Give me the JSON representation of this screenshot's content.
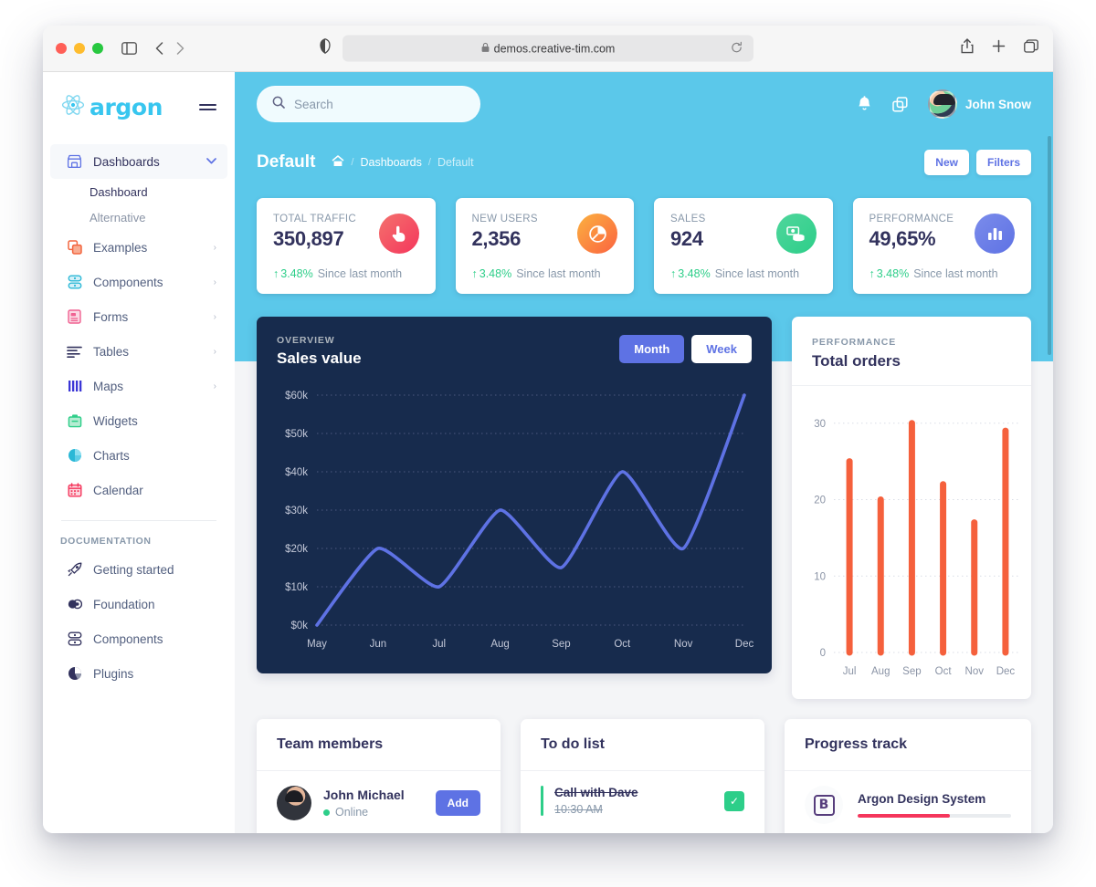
{
  "browser": {
    "url": "demos.creative-tim.com",
    "lock_icon": "lock-icon",
    "reload_icon": "reload-icon",
    "sidebar_icon": "sidebar-toggle-icon",
    "back_icon": "chevron-left-icon",
    "forward_icon": "chevron-right-icon",
    "shield_icon": "privacy-shield-icon",
    "share_icon": "share-icon",
    "new_tab_icon": "plus-icon",
    "tabs_icon": "tab-overview-icon"
  },
  "sidebar": {
    "logo_text": "argon",
    "logo_icon": "react-atom-icon",
    "burger_icon": "hamburger-icon",
    "items": [
      {
        "label": "Dashboards",
        "icon": "store-icon",
        "color": "#5e72e4",
        "caret": "chevron-down-icon",
        "active": true
      },
      {
        "label": "Examples",
        "icon": "copy-layers-icon",
        "color": "#f3663f",
        "caret": "chevron-right-icon",
        "active": false
      },
      {
        "label": "Components",
        "icon": "components-icon",
        "color": "#2bb8d6",
        "caret": "chevron-right-icon",
        "active": false
      },
      {
        "label": "Forms",
        "icon": "form-icon",
        "color": "#f06292",
        "caret": "chevron-right-icon",
        "active": false
      },
      {
        "label": "Tables",
        "icon": "table-lines-icon",
        "color": "#32325d",
        "caret": "chevron-right-icon",
        "active": false
      },
      {
        "label": "Maps",
        "icon": "bars-map-icon",
        "color": "#3b36d6",
        "caret": "chevron-right-icon",
        "active": false
      },
      {
        "label": "Widgets",
        "icon": "widget-box-icon",
        "color": "#2dce89",
        "caret": "",
        "active": false
      },
      {
        "label": "Charts",
        "icon": "pie-chart-icon",
        "color": "#2bb8d6",
        "caret": "",
        "active": false
      },
      {
        "label": "Calendar",
        "icon": "calendar-icon",
        "color": "#f5365c",
        "caret": "",
        "active": false
      }
    ],
    "sub_items": [
      {
        "label": "Dashboard",
        "current": true
      },
      {
        "label": "Alternative",
        "current": false
      }
    ],
    "doc_heading": "DOCUMENTATION",
    "doc_items": [
      {
        "label": "Getting started",
        "icon": "rocket-icon"
      },
      {
        "label": "Foundation",
        "icon": "foundation-icon"
      },
      {
        "label": "Components",
        "icon": "components-icon"
      },
      {
        "label": "Plugins",
        "icon": "plugins-pie-icon"
      }
    ]
  },
  "navbar": {
    "search_placeholder": "Search",
    "search_value": "",
    "search_icon": "search-icon",
    "bell_icon": "bell-icon",
    "layers_icon": "copy-layers-icon",
    "user_name": "John Snow",
    "avatar_name": "avatar"
  },
  "header": {
    "page_title": "Default",
    "home_icon": "home-icon",
    "breadcrumbs": [
      "Dashboards",
      "Default"
    ],
    "actions": [
      {
        "label": "New",
        "name": "new-button"
      },
      {
        "label": "Filters",
        "name": "filters-button"
      }
    ]
  },
  "stats": [
    {
      "label": "TOTAL TRAFFIC",
      "value": "350,897",
      "delta": "3.48%",
      "since": "Since last month",
      "icon": "hand-pointer-icon",
      "color": "#f5365c",
      "color2": "#f3716d"
    },
    {
      "label": "NEW USERS",
      "value": "2,356",
      "delta": "3.48%",
      "since": "Since last month",
      "icon": "pie-chart-icon",
      "color": "#fb6340",
      "color2": "#fbb140"
    },
    {
      "label": "SALES",
      "value": "924",
      "delta": "3.48%",
      "since": "Since last month",
      "icon": "money-coins-icon",
      "color": "#2dce89",
      "color2": "#4fd69c"
    },
    {
      "label": "PERFORMANCE",
      "value": "49,65%",
      "delta": "3.48%",
      "since": "Since last month",
      "icon": "bar-chart-icon",
      "color": "#5e72e4",
      "color2": "#7b8ceb"
    }
  ],
  "sales_panel": {
    "eyebrow": "OVERVIEW",
    "title": "Sales value",
    "buttons": [
      {
        "label": "Month",
        "active": true
      },
      {
        "label": "Week",
        "active": false
      }
    ]
  },
  "orders_panel": {
    "eyebrow": "PERFORMANCE",
    "title": "Total orders"
  },
  "team": {
    "title": "Team members",
    "members": [
      {
        "name": "John Michael",
        "status": "Online",
        "action": "Add"
      }
    ]
  },
  "todo": {
    "title": "To do list",
    "items": [
      {
        "text": "Call with Dave",
        "time": "10:30 AM",
        "done": true,
        "check_icon": "check-icon"
      }
    ]
  },
  "progress": {
    "title": "Progress track",
    "items": [
      {
        "name": "Argon Design System",
        "icon": "bootstrap-icon",
        "icon_letter": "B",
        "percent": 60
      }
    ]
  },
  "chart_data": [
    {
      "type": "line",
      "title": "Sales value",
      "subtitle": "OVERVIEW",
      "categories": [
        "May",
        "Jun",
        "Jul",
        "Aug",
        "Sep",
        "Oct",
        "Nov",
        "Dec"
      ],
      "values": [
        0,
        20000,
        10000,
        30000,
        15000,
        40000,
        20000,
        60000
      ],
      "ytick_labels": [
        "$0k",
        "$10k",
        "$20k",
        "$30k",
        "$40k",
        "$50k",
        "$60k"
      ],
      "ytick_values": [
        0,
        10000,
        20000,
        30000,
        40000,
        50000,
        60000
      ],
      "ylim": [
        0,
        60000
      ],
      "xlabel": "",
      "ylabel": "",
      "grid": true,
      "line_color": "#5e72e4",
      "background": "#172b4d",
      "legend": "none"
    },
    {
      "type": "bar",
      "title": "Total orders",
      "subtitle": "PERFORMANCE",
      "categories": [
        "Jul",
        "Aug",
        "Sep",
        "Oct",
        "Nov",
        "Dec"
      ],
      "values": [
        25,
        20,
        30,
        22,
        17,
        29
      ],
      "ytick_labels": [
        "0",
        "10",
        "20",
        "30"
      ],
      "ytick_values": [
        0,
        10,
        20,
        30
      ],
      "ylim": [
        0,
        32
      ],
      "xlabel": "",
      "ylabel": "",
      "grid": true,
      "bar_color": "#f5603c",
      "background": "#ffffff",
      "legend": "none"
    }
  ],
  "theme": {
    "header_cyan": "#5bc8ea",
    "page_bg": "#f4f5f7",
    "primary": "#5e72e4",
    "dark_card": "#172b4d",
    "text_dark": "#32325d",
    "text_muted": "#8898aa",
    "success": "#2dce89",
    "orange": "#f5603c"
  }
}
